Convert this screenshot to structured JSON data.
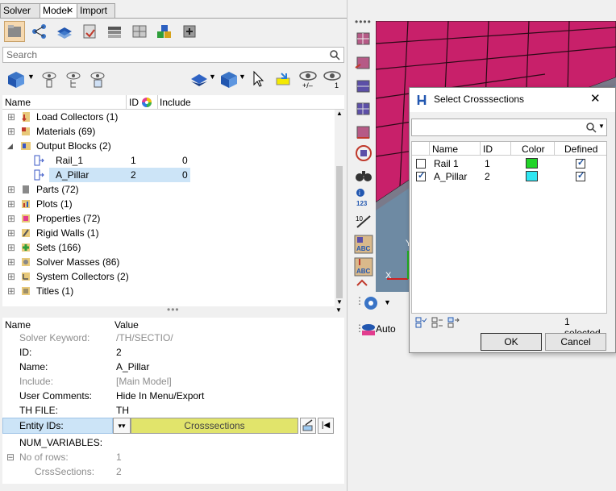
{
  "tabs": [
    {
      "label": "Solver"
    },
    {
      "label": "Model"
    },
    {
      "label": "Import"
    }
  ],
  "tab_close_glyph": "×",
  "search": {
    "placeholder": "Search"
  },
  "tree": {
    "headers": {
      "name": "Name",
      "id": "ID",
      "include": "Include"
    },
    "items": [
      {
        "label": "Load Collectors (1)",
        "icon": "load-collector-icon",
        "color": "#c0392b"
      },
      {
        "label": "Materials (69)",
        "icon": "material-icon",
        "color": "#c0392b"
      },
      {
        "label": "Output Blocks (2)",
        "icon": "output-block-icon",
        "color": "#3a57c6"
      },
      {
        "label": "Rail_1",
        "id": "1",
        "include": "0",
        "icon": "output-block-icon"
      },
      {
        "label": "A_Pillar",
        "id": "2",
        "include": "0",
        "icon": "output-block-icon"
      },
      {
        "label": "Parts (72)",
        "icon": "part-icon"
      },
      {
        "label": "Plots (1)",
        "icon": "plot-icon"
      },
      {
        "label": "Properties (72)",
        "icon": "property-icon"
      },
      {
        "label": "Rigid Walls (1)",
        "icon": "rigid-wall-icon"
      },
      {
        "label": "Sets (166)",
        "icon": "set-icon"
      },
      {
        "label": "Solver Masses (86)",
        "icon": "solver-mass-icon"
      },
      {
        "label": "System Collectors (2)",
        "icon": "system-collector-icon"
      },
      {
        "label": "Titles (1)",
        "icon": "title-icon"
      }
    ]
  },
  "props": {
    "headers": {
      "name": "Name",
      "value": "Value"
    },
    "rows": [
      {
        "key": "Solver Keyword:",
        "value": "/TH/SECTIO/",
        "muted": true
      },
      {
        "key": "ID:",
        "value": "2",
        "muted": false
      },
      {
        "key": "Name:",
        "value": "A_Pillar",
        "muted": false
      },
      {
        "key": "Include:",
        "value": "[Main Model]",
        "muted": true
      },
      {
        "key": "User Comments:",
        "value": "Hide In Menu/Export",
        "muted": false
      },
      {
        "key": "TH FILE:",
        "value": "TH",
        "muted": false
      },
      {
        "key": "Entity IDs:",
        "value": "Crosssections",
        "muted": false
      },
      {
        "key": "NUM_VARIABLES:",
        "value": "",
        "muted": false
      },
      {
        "key": "No of rows:",
        "value": "1",
        "muted": true
      },
      {
        "key": "CrssSections:",
        "value": "2",
        "muted": true
      }
    ]
  },
  "viewport": {
    "axis_x": "X",
    "axis_y": "Y",
    "auto_label": "Auto"
  },
  "dialog": {
    "title": "Select Crosssections",
    "close_glyph": "✕",
    "headers": {
      "name": "Name",
      "id": "ID",
      "color": "Color",
      "defined": "Defined"
    },
    "rows": [
      {
        "name": "Rail 1",
        "id": "1",
        "color": "#21d428",
        "checked": false,
        "defined": true
      },
      {
        "name": "A_Pillar",
        "id": "2",
        "color": "#2fe6f2",
        "checked": true,
        "defined": true
      }
    ],
    "status": "1 selected.",
    "ok_label": "OK",
    "cancel_label": "Cancel"
  },
  "colors": {
    "selection": "#cce4f7",
    "entity_ids_value": "#e1e46b",
    "mesh_magenta": "#c8206a"
  }
}
